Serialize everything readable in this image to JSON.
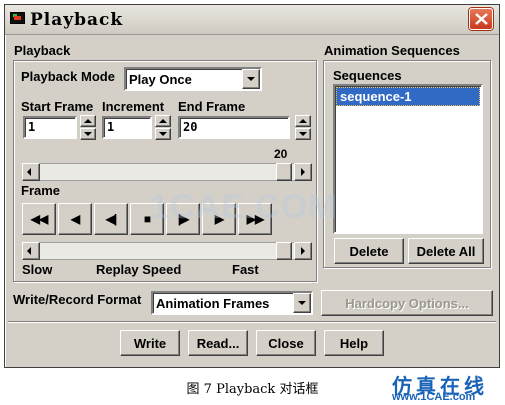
{
  "window": {
    "title": "Playback",
    "colors": {
      "face": "#d4d0c8",
      "selection": "#316ac5",
      "close_button": "#d5562f"
    }
  },
  "playback": {
    "group_label": "Playback",
    "mode_label": "Playback Mode",
    "mode_value": "Play Once",
    "start_frame_label": "Start Frame",
    "start_frame_value": "1",
    "increment_label": "Increment",
    "increment_value": "1",
    "end_frame_label": "End Frame",
    "end_frame_value": "20",
    "frame_slider_value": "20",
    "frame_label": "Frame",
    "slow_label": "Slow",
    "replay_speed_label": "Replay Speed",
    "fast_label": "Fast"
  },
  "controls": [
    {
      "name": "rewind",
      "glyph": "◀◀"
    },
    {
      "name": "play-reverse",
      "glyph": "◀"
    },
    {
      "name": "step-back",
      "glyph": "◀|"
    },
    {
      "name": "stop",
      "glyph": "■"
    },
    {
      "name": "step-forward",
      "glyph": "|▶"
    },
    {
      "name": "play",
      "glyph": "▶"
    },
    {
      "name": "fast-forward",
      "glyph": "▶▶"
    }
  ],
  "animation_sequences": {
    "group_label": "Animation Sequences",
    "sequences_label": "Sequences",
    "items": [
      "sequence-1"
    ],
    "delete_label": "Delete",
    "delete_all_label": "Delete All"
  },
  "write_record": {
    "label": "Write/Record Format",
    "value": "Animation Frames",
    "hardcopy_label": "Hardcopy Options..."
  },
  "buttons": {
    "write": "Write",
    "read": "Read...",
    "close": "Close",
    "help": "Help"
  },
  "caption": "图 7 Playback 对话框",
  "watermark": "1CAE.COM",
  "brand": {
    "name": "仿真在线",
    "url": "www.1CAE.com"
  }
}
